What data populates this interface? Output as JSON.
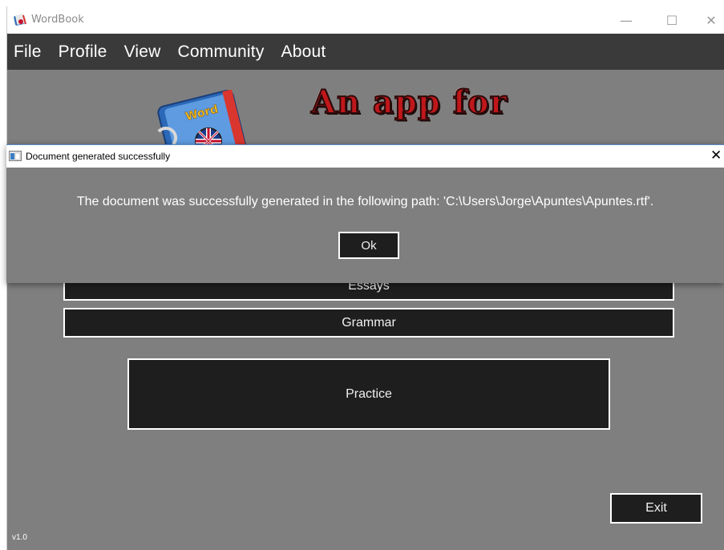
{
  "window": {
    "title": "WordBook",
    "minimize_glyph": "—",
    "maximize_glyph": "☐",
    "close_glyph": "✕"
  },
  "menu": {
    "items": [
      "File",
      "Profile",
      "View",
      "Community",
      "About"
    ]
  },
  "banner": {
    "logo_word": "Word",
    "headline": "An app for"
  },
  "main": {
    "essays_label": "Essays",
    "grammar_label": "Grammar",
    "practice_label": "Practice",
    "exit_label": "Exit",
    "version": "v1.0"
  },
  "dialog": {
    "title": "Document generated successfully",
    "message": "The document was successfully generated in the following path: 'C:\\Users\\Jorge\\Apuntes\\Apuntes.rtf'.",
    "ok_label": "Ok",
    "close_glyph": "✕"
  },
  "colors": {
    "background": "#7f7f7f",
    "menubar": "#3a3a3a",
    "button_fill": "#1e1e1e",
    "headline_red": "#c0171b"
  },
  "icons": [
    "wordbook-app-icon",
    "dialog-window-icon",
    "wordbook-logo-icon"
  ]
}
